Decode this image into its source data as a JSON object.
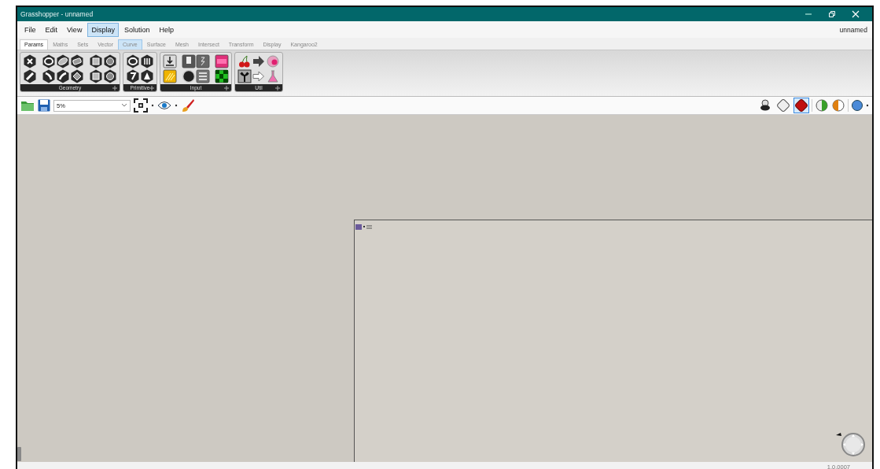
{
  "window": {
    "title": "Grasshopper - unnamed"
  },
  "menu": [
    {
      "label": "File",
      "selected": false
    },
    {
      "label": "Edit",
      "selected": false
    },
    {
      "label": "View",
      "selected": false
    },
    {
      "label": "Display",
      "selected": true
    },
    {
      "label": "Solution",
      "selected": false
    },
    {
      "label": "Help",
      "selected": false
    }
  ],
  "document_name": "unnamed",
  "tabs": [
    {
      "label": "Params",
      "selected": true,
      "hovered": false
    },
    {
      "label": "Maths",
      "selected": false,
      "hovered": false
    },
    {
      "label": "Sets",
      "selected": false,
      "hovered": false
    },
    {
      "label": "Vector",
      "selected": false,
      "hovered": false
    },
    {
      "label": "Curve",
      "selected": false,
      "hovered": true
    },
    {
      "label": "Surface",
      "selected": false,
      "hovered": false
    },
    {
      "label": "Mesh",
      "selected": false,
      "hovered": false
    },
    {
      "label": "Intersect",
      "selected": false,
      "hovered": false
    },
    {
      "label": "Transform",
      "selected": false,
      "hovered": false
    },
    {
      "label": "Display",
      "selected": false,
      "hovered": false
    },
    {
      "label": "Kangaroo2",
      "selected": false,
      "hovered": false
    }
  ],
  "ribbon_groups": [
    {
      "label": "Geometry"
    },
    {
      "label": "Primitive"
    },
    {
      "label": "Input"
    },
    {
      "label": "Util"
    }
  ],
  "zoom": {
    "value": "5%"
  },
  "preview_buttons": [
    {
      "selected": false
    },
    {
      "selected": false
    },
    {
      "selected": true
    }
  ],
  "status_bar": {
    "version": "1.0.0007"
  }
}
